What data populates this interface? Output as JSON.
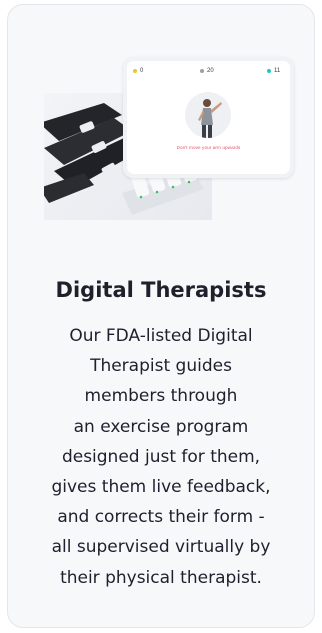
{
  "card": {
    "title": "Digital Therapists",
    "description_lines": [
      "Our FDA-listed Digital",
      "Therapist guides",
      "members through",
      "an exercise program",
      "designed just for them,",
      "gives them live feedback,",
      "and corrects their form -",
      "all supervised virtually by",
      "their physical therapist."
    ]
  },
  "tablet": {
    "stats": [
      {
        "value": "0",
        "color": "#f2c230"
      },
      {
        "value": "20",
        "color": "#9aa0aa"
      },
      {
        "value": "11",
        "color": "#1fc8c0"
      }
    ],
    "warning": "Don't move your arm upwards"
  },
  "colors": {
    "card_background": "#f7f8fa",
    "card_border": "#e3e6ec",
    "warning": "#e0556a",
    "text": "#1f1f2e"
  }
}
